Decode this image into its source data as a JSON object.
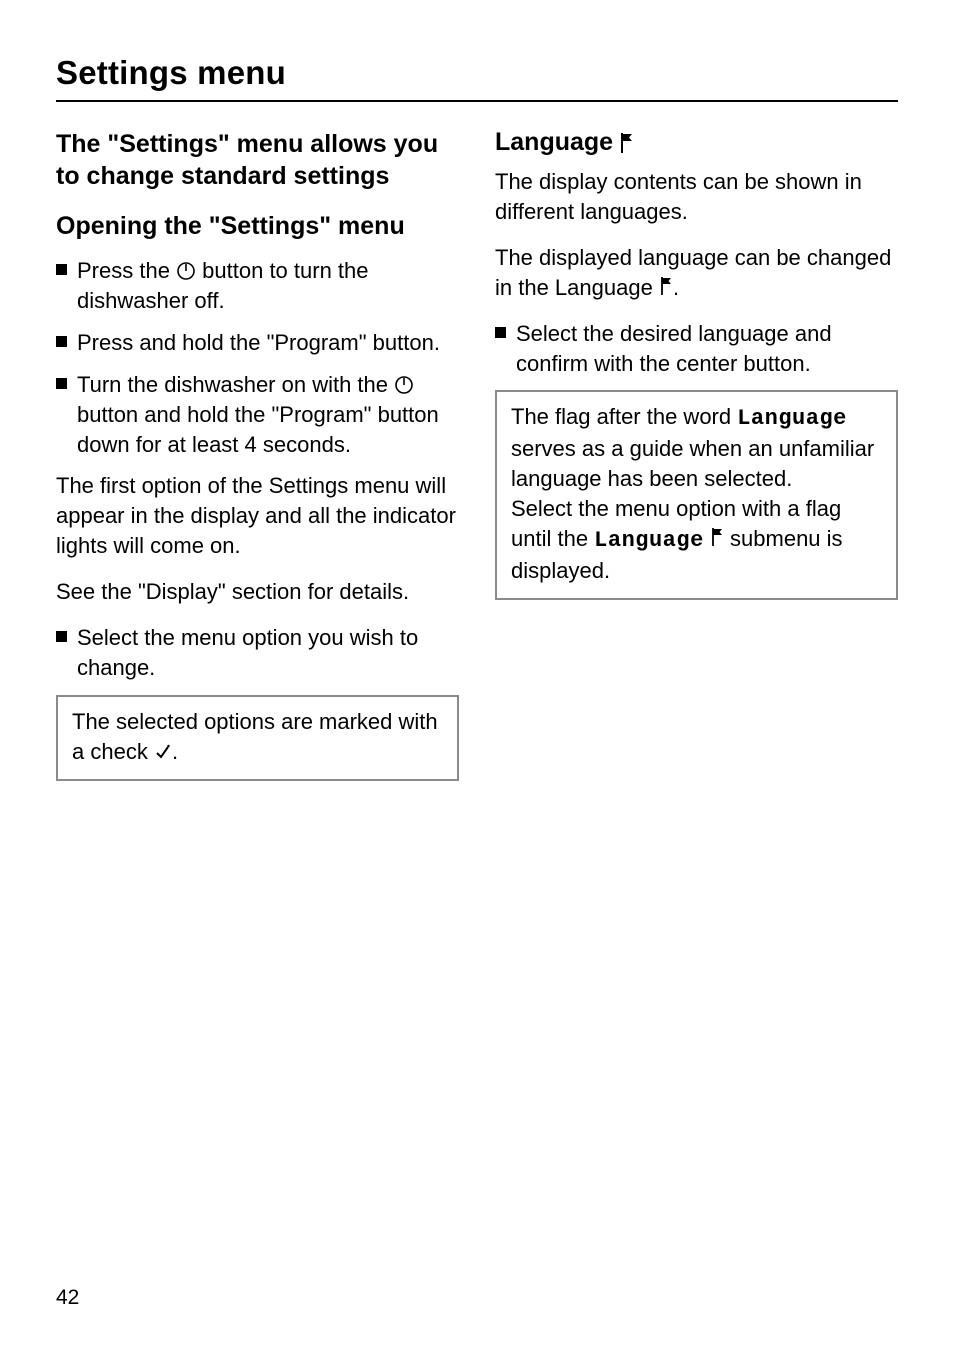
{
  "pageTitle": "Settings menu",
  "pageNumber": "42",
  "left": {
    "intro": "The \"Settings\" menu allows you to change standard settings",
    "openHeading": "Opening the \"Settings\" menu",
    "step1a": "Press the ",
    "step1b": " button to turn the dishwasher off.",
    "step2": "Press and hold the \"Program\" button.",
    "step3a": "Turn the dishwasher on with the ",
    "step3b": " button and hold the \"Program\" button down for at least 4 seconds.",
    "para1": "The first option of the Settings menu will appear in the display and all the indicator lights will come on.",
    "para2": "See the \"Display\" section for details.",
    "step4": "Select the menu option you wish to change.",
    "noteA": "The selected options are marked with a  check ",
    "noteB": "."
  },
  "right": {
    "langHeading": "Language",
    "para1": "The display contents can be shown in different languages.",
    "para2a": "The displayed language can be changed in the Language ",
    "para2b": ".",
    "step1": "Select the desired language and confirm with the center button.",
    "noteA": "The flag after the word ",
    "noteLcd1": "Language",
    "noteB": " serves as a guide when an unfamiliar language has been selected.",
    "noteC": "Select the menu option with a flag until the ",
    "noteLcd2": "Language",
    "noteD": "  submenu is displayed."
  }
}
